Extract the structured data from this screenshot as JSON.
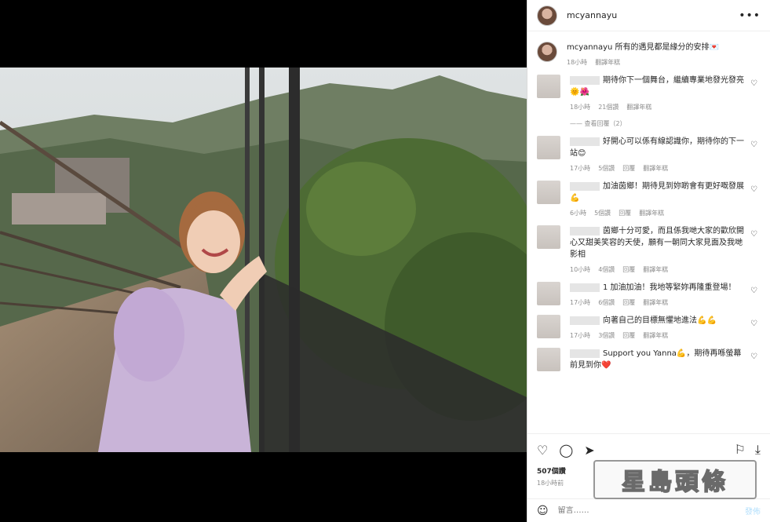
{
  "post": {
    "username": "mcyannayu",
    "caption": "所有的遇見都是緣分的安排💌",
    "caption_time": "18小時",
    "translate": "翻譯年糕",
    "likes": "507個讚",
    "posted_ago": "18小時前"
  },
  "comments": [
    {
      "text": "期待你下一個舞台，繼續專業地發光發亮🌞🌺",
      "time": "18小時",
      "likes": "21個讚",
      "reply": "",
      "translate": "翻譯年糕"
    },
    {
      "text": "好開心可以係有線認識你，期待你的下一站😊",
      "time": "17小時",
      "likes": "5個讚",
      "reply": "回覆",
      "translate": "翻譯年糕"
    },
    {
      "text": "加油茵鄉！期待見到妳啲會有更好嘅發展💪",
      "time": "6小時",
      "likes": "5個讚",
      "reply": "回覆",
      "translate": "翻譯年糕"
    },
    {
      "text": "茵鄉十分可愛，而且係我哋大家的歡欣開心又甜美笑容的天使，願有一朝同大家見面及我哋影相",
      "time": "10小時",
      "likes": "4個讚",
      "reply": "回覆",
      "translate": "翻譯年糕"
    },
    {
      "text": "1 加油加油！我地等緊妳再隆重登場！",
      "time": "17小時",
      "likes": "6個讚",
      "reply": "回覆",
      "translate": "翻譯年糕"
    },
    {
      "text": "向著自己的目標無懼地進法💪💪",
      "time": "17小時",
      "likes": "3個讚",
      "reply": "回覆",
      "translate": "翻譯年糕"
    },
    {
      "text": "Support you Yanna💪，期待再喺螢幕前見到你❤️",
      "time": "",
      "likes": "",
      "reply": "",
      "translate": ""
    }
  ],
  "view_replies": "查看回覆（2）",
  "composer": {
    "placeholder": "留言……",
    "post": "發佈"
  },
  "icons": {
    "more": "more-icon",
    "like": "heart-icon",
    "comment": "comment-icon",
    "share": "share-icon",
    "save": "bookmark-icon",
    "download": "download-icon",
    "emoji": "emoji-icon"
  },
  "watermark": "星島頭條",
  "colors": {
    "accent": "#0095f6",
    "post_disabled": "#b2dffc",
    "dress": "#c9b4d8"
  }
}
